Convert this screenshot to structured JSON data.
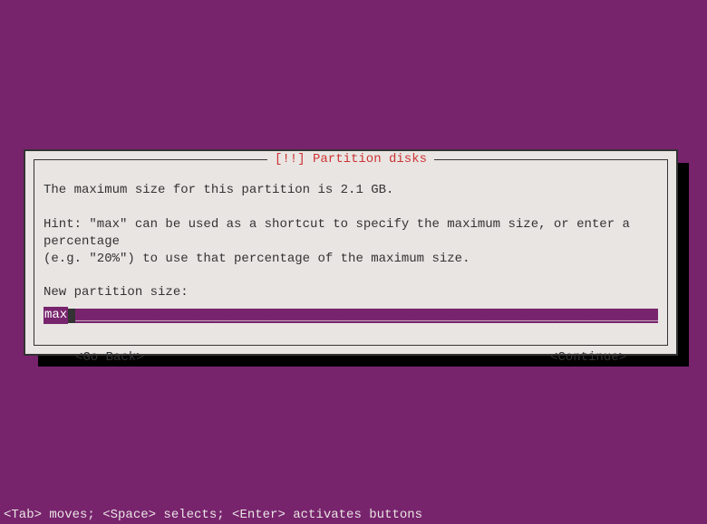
{
  "dialog": {
    "title": "[!!] Partition disks",
    "line1": "The maximum size for this partition is 2.1 GB.",
    "hint1": "Hint: \"max\" can be used as a shortcut to specify the maximum size, or enter a percentage",
    "hint2": "(e.g. \"20%\") to use that percentage of the maximum size.",
    "prompt": "New partition size:",
    "input_value": "max",
    "underscore_fill": "________________________________________________________________________________________",
    "go_back": "<Go Back>",
    "continue": "<Continue>"
  },
  "status": "<Tab> moves; <Space> selects; <Enter> activates buttons"
}
